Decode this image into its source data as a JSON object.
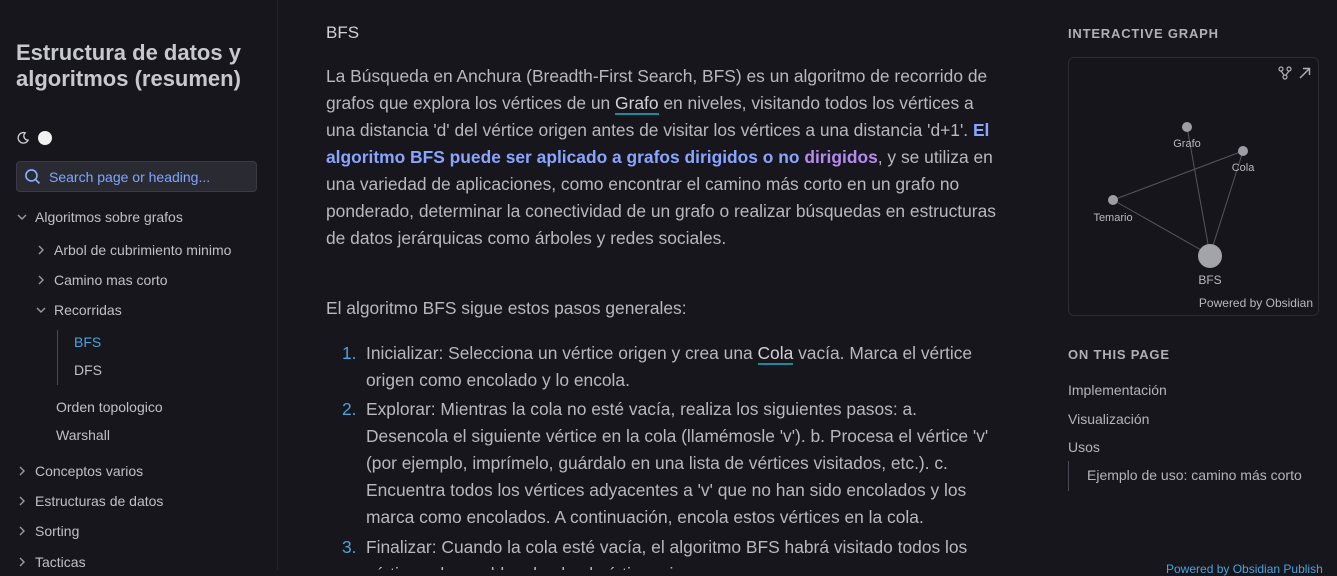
{
  "sidebar": {
    "title": "Estructura de datos y algoritmos (resumen)",
    "search_placeholder": "Search page or heading...",
    "nav": [
      {
        "label": "Algoritmos sobre grafos",
        "state": "expanded"
      },
      {
        "label": "Arbol de cubrimiento minimo",
        "state": "collapsed"
      },
      {
        "label": "Camino mas corto",
        "state": "collapsed"
      },
      {
        "label": "Recorridas",
        "state": "expanded"
      },
      {
        "label": "BFS",
        "state": "active"
      },
      {
        "label": "DFS",
        "state": "leaf"
      },
      {
        "label": "Orden topologico",
        "state": "leaf"
      },
      {
        "label": "Warshall",
        "state": "leaf"
      },
      {
        "label": "Conceptos varios",
        "state": "collapsed"
      },
      {
        "label": "Estructuras de datos",
        "state": "collapsed"
      },
      {
        "label": "Sorting",
        "state": "collapsed"
      },
      {
        "label": "Tacticas",
        "state": "collapsed"
      }
    ]
  },
  "article": {
    "heading": "BFS",
    "p1": {
      "t1": "La Búsqueda en Anchura (Breadth-First Search, BFS) es un algoritmo de recorrido de grafos que explora los vértices de un ",
      "link": "Grafo",
      "t2": " en niveles, visitando todos los vértices a una distancia 'd' del vértice origen antes de visitar los vértices a una distancia 'd+1'. ",
      "hl1": "El algoritmo BFS puede ser aplicado a grafos dirigidos o no",
      "hl2": "dirigidos",
      "t3": ", y se utiliza en una variedad de aplicaciones, como encontrar el camino más corto en un grafo no ponderado, determinar la conectividad de un grafo o realizar búsquedas en estructuras de datos jerárquicas como árboles y redes sociales."
    },
    "p2": "El algoritmo BFS sigue estos pasos generales:",
    "steps": [
      {
        "num": "1.",
        "a": " Inicializar: Selecciona un vértice origen y crea una ",
        "link": "Cola",
        "b": " vacía. Marca el vértice origen como encolado y lo encola."
      },
      {
        "num": "2.",
        "a": " Explorar: Mientras la cola no esté vacía, realiza los siguientes pasos: a. Desencola el siguiente vértice en la cola (llamémosle 'v'). b. Procesa el vértice 'v' (por ejemplo, imprímelo, guárdalo en una lista de vértices visitados, etc.). c. Encuentra todos los vértices adyacentes a 'v' que no han sido encolados y los marca como encolados. A continuación, encola estos vértices en la cola."
      },
      {
        "num": "3.",
        "a": " Finalizar: Cuando la cola esté vacía, el algoritmo BFS habrá visitado todos los vértices alcanzables desde el vértice origen."
      }
    ]
  },
  "graph": {
    "title": "INTERACTIVE GRAPH",
    "nodes": [
      {
        "id": "Grafo",
        "label": "Grafo"
      },
      {
        "id": "Cola",
        "label": "Cola"
      },
      {
        "id": "Temario",
        "label": "Temario"
      },
      {
        "id": "BFS",
        "label": "BFS"
      }
    ],
    "powered_by": "Powered by Obsidian"
  },
  "toc": {
    "title": "ON THIS PAGE",
    "items": [
      "Implementación",
      "Visualización",
      "Usos",
      "Ejemplo de uso: camino más corto"
    ]
  },
  "footer": {
    "text": "Powered by Obsidian Publish"
  },
  "colors": {
    "accent": "#4ba3d9",
    "highlight_blue": "#8aa5ff",
    "highlight_purple": "#b48cf0",
    "background": "#17161d"
  }
}
